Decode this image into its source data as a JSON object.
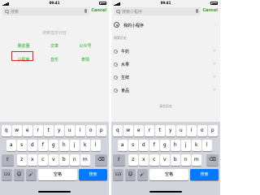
{
  "left": {
    "status": {
      "time": "09:41"
    },
    "search": {
      "placeholder": "搜索",
      "cancel_label": "Cancel"
    },
    "hint_title": "搜索指定内容",
    "categories": [
      "朋友圈",
      "文章",
      "公众号",
      "小程序",
      "音乐",
      "表情"
    ],
    "highlighted_category": "小程序"
  },
  "right": {
    "status": {
      "time": "09:41"
    },
    "search": {
      "placeholder": "搜索小程序",
      "cancel_label": "Cancel"
    },
    "my_miniprogram_label": "我的小程序",
    "history_title": "搜索历史",
    "history": [
      "牛奶",
      "水果",
      "生鲜",
      "食品"
    ],
    "clear_history": "清空历史"
  },
  "keyboard": {
    "row1": [
      "q",
      "w",
      "e",
      "r",
      "t",
      "y",
      "u",
      "i",
      "o",
      "p"
    ],
    "row2": [
      "a",
      "s",
      "d",
      "f",
      "g",
      "h",
      "j",
      "k",
      "l"
    ],
    "row3": [
      "z",
      "x",
      "c",
      "v",
      "b",
      "n",
      "m"
    ],
    "num_label": "123",
    "space_label": "空格",
    "go_label": "搜索",
    "shift_glyph": "⇧",
    "delete_glyph": "⌫",
    "emoji_glyph": "☺",
    "mic_glyph": "🎤"
  },
  "colors": {
    "accent": "#1aad19",
    "highlight": "#e02020",
    "go_key": "#007aff"
  }
}
